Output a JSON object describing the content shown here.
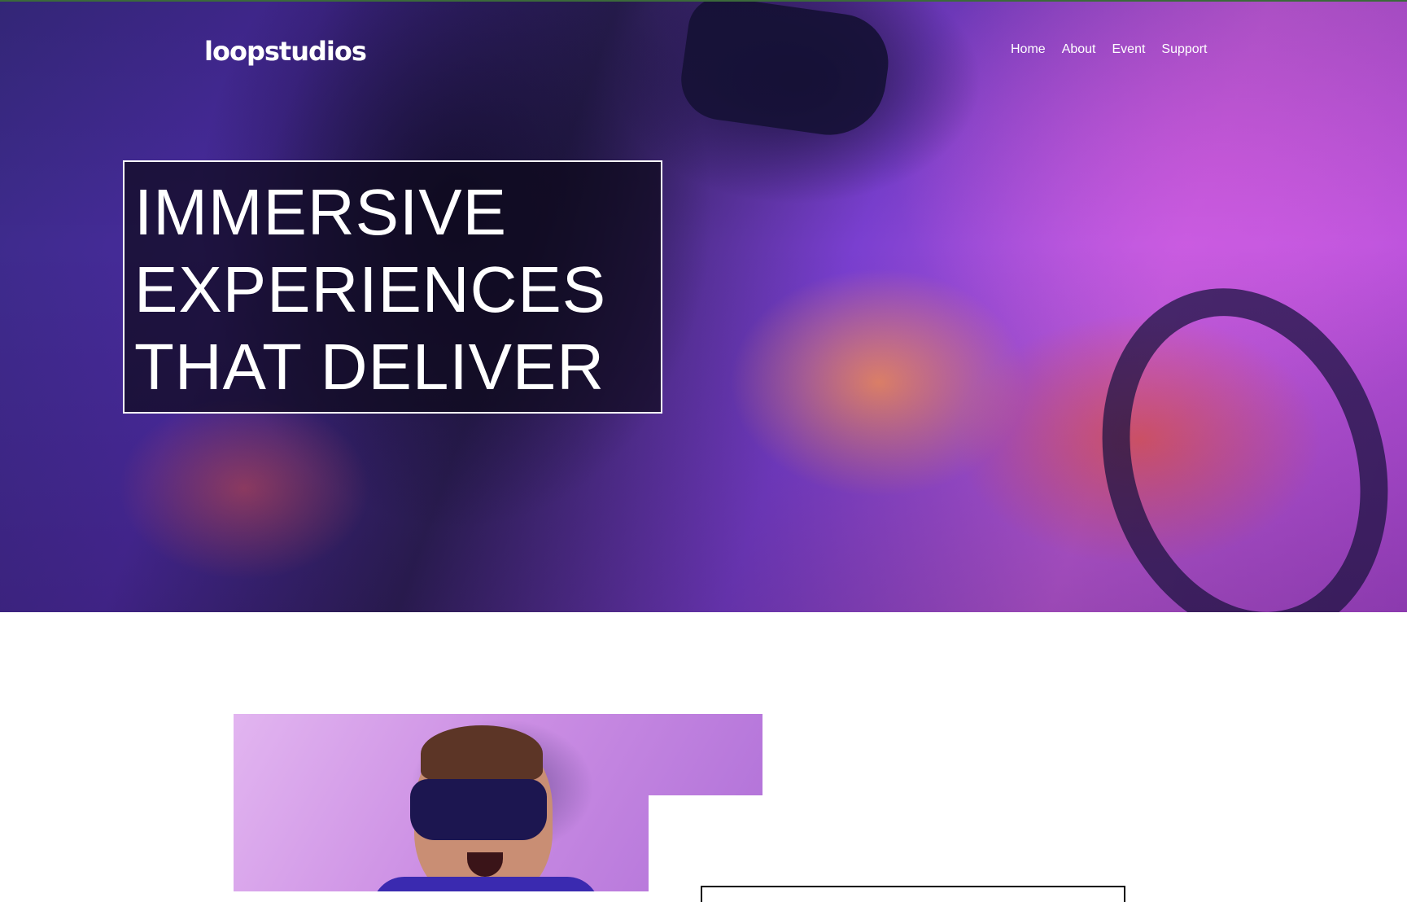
{
  "header": {
    "logo": "loopstudios",
    "nav": [
      {
        "label": "Home"
      },
      {
        "label": "About"
      },
      {
        "label": "Event"
      },
      {
        "label": "Support"
      }
    ]
  },
  "hero": {
    "headline_lines": [
      "IMMERSIVE",
      "EXPERIENCES",
      "THAT DELIVER"
    ]
  },
  "colors": {
    "hero_overlay": "#0e0a1c",
    "text": "#ffffff",
    "top_border": "#3b6a3a",
    "page_background": "#ffffff"
  }
}
